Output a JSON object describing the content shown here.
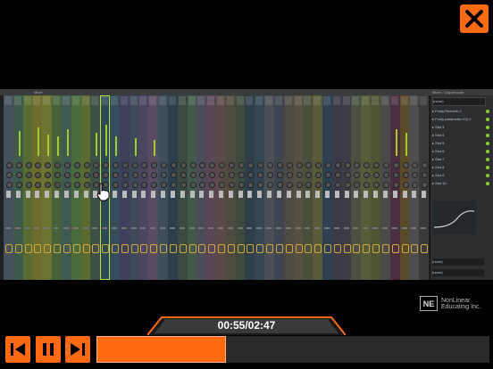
{
  "app": {
    "close_label": "close",
    "mixer_title": "Mixer",
    "mixer_panel_title": "Mixer - ClapsHouse"
  },
  "mixer": {
    "strip_colors": [
      "#44505c",
      "#3d5a4b",
      "#5a6a33",
      "#6a6d2c",
      "#6f7332",
      "#47623a",
      "#3f5a52",
      "#4a6c3c",
      "#5c6a2f",
      "#3e4f45",
      "#2d4a53",
      "#344c5c",
      "#3e3f5a",
      "#3f4858",
      "#4a4660",
      "#584b62",
      "#3d4f5a",
      "#2d3f4c",
      "#3a4a3f",
      "#435a4a",
      "#4c4b58",
      "#5b4658",
      "#5a4a47",
      "#4f4a3f",
      "#3e4a3e",
      "#2f3f4a",
      "#354653",
      "#4a4f55",
      "#3d4550",
      "#4e4a42",
      "#575045",
      "#4a4f3c",
      "#595a3a",
      "#2f4050",
      "#3a3a48",
      "#3f3c46",
      "#4b5042",
      "#555c3a",
      "#4e5535",
      "#4a4a4a",
      "#4b2f40",
      "#5a4a2a",
      "#4d4d4d",
      "#3a3a3a"
    ],
    "meter_heights": [
      0,
      28,
      0,
      32,
      24,
      22,
      30,
      0,
      0,
      26,
      35,
      22,
      0,
      20,
      0,
      18,
      0,
      0,
      0,
      0,
      0,
      0,
      0,
      0,
      0,
      0,
      0,
      0,
      0,
      0,
      0,
      0,
      0,
      0,
      0,
      0,
      0,
      0,
      0,
      0,
      30,
      26,
      0,
      0
    ],
    "active_strip": 10
  },
  "right_panel": {
    "dropdown_label": "(none)",
    "slots": [
      "Fruity Reeverb 2",
      "Fruity parametric EQ 2",
      "Slot 3",
      "Slot 4",
      "Slot 5",
      "Slot 6",
      "Slot 7",
      "Slot 8",
      "Slot 9",
      "Slot 10"
    ],
    "bottom_label_1": "(none)",
    "bottom_label_2": "(none)"
  },
  "brand": {
    "logo_letters": "NE",
    "line1": "NonLinear",
    "line2": "Educating Inc."
  },
  "player": {
    "time_display": "00:55/02:47",
    "progress_fraction": 0.329,
    "accent": "#ff6a13"
  }
}
